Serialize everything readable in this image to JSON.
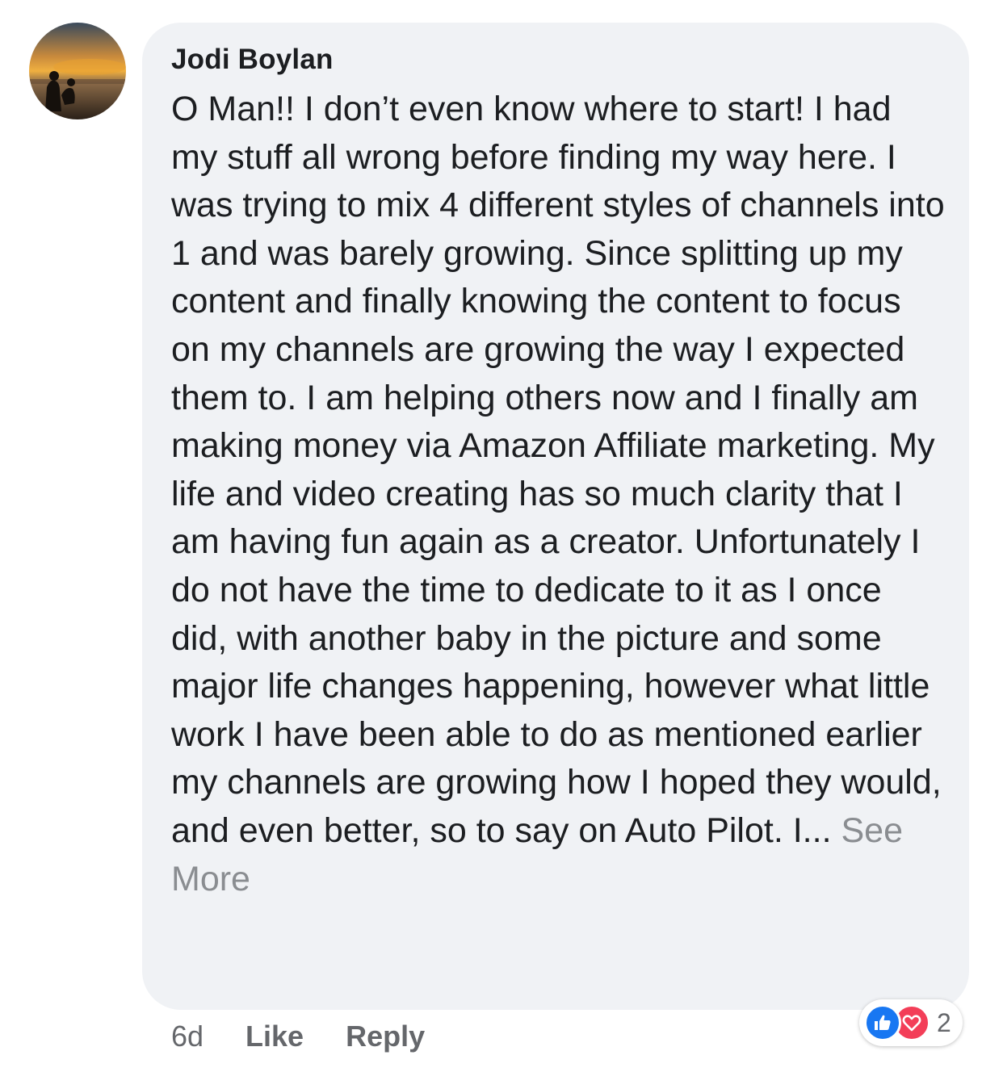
{
  "comment": {
    "author": "Jodi Boylan",
    "text": "O Man!! I don’t even know where to start! I had my stuff all wrong before finding my way here. I was trying to mix 4 different styles of channels into 1 and was barely growing. Since splitting up my content and finally knowing the content to focus on my channels are growing the way I expected them to. I am helping others now and I finally am making money via Amazon Affiliate marketing. My life and video creating has so much clarity that I am having fun again as a creator. Unfortunately I do not have the time to dedicate to it as I once did, with another baby in the picture and some major life changes happening, however what little work I have been able to do as mentioned earlier my channels are growing how I hoped they would, and even better, so to say on Auto Pilot. I...",
    "see_more": "See More",
    "timestamp": "6d",
    "like_label": "Like",
    "reply_label": "Reply",
    "reactions": {
      "icons": [
        "like-icon",
        "love-icon"
      ],
      "count": "2"
    }
  },
  "colors": {
    "bubble": "#f0f2f5",
    "text": "#1c1e21",
    "secondary": "#65676b",
    "see_more": "#8a8d91",
    "like": "#1877f2",
    "love": "#f33e58"
  }
}
